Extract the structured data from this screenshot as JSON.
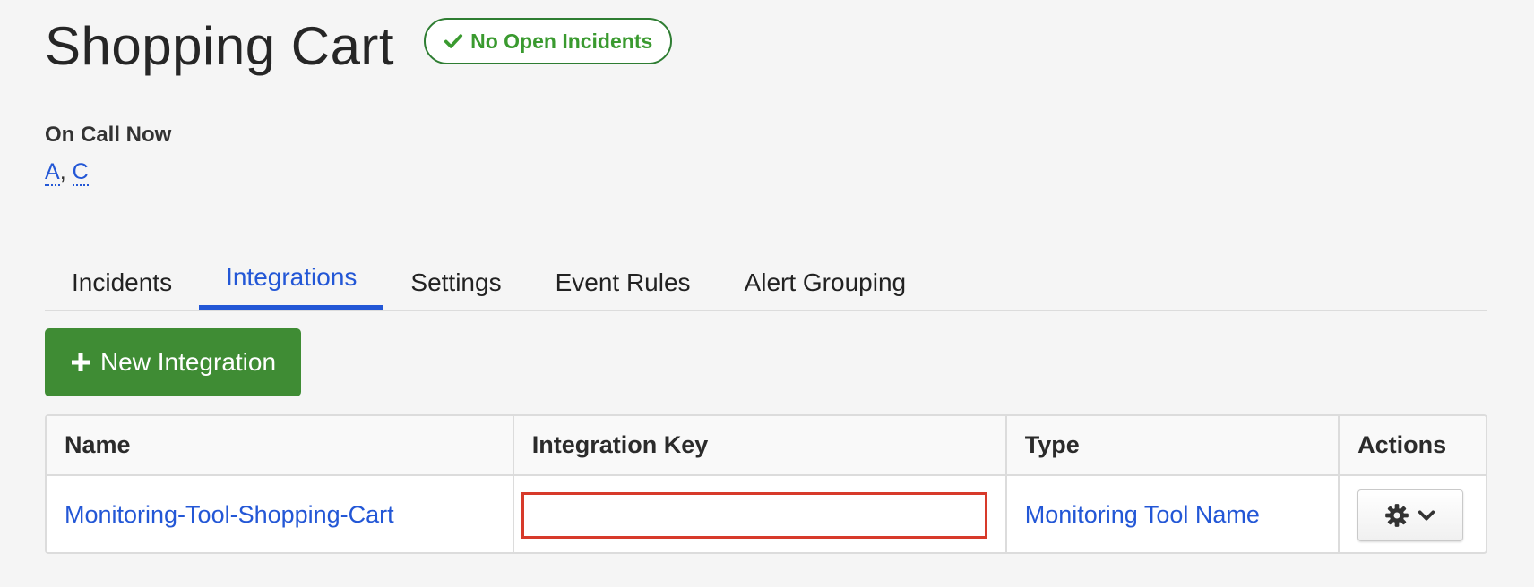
{
  "service": {
    "title": "Shopping Cart",
    "status_badge": "No Open Incidents"
  },
  "oncall": {
    "label": "On Call Now",
    "users": [
      "A",
      "C"
    ],
    "separator": ","
  },
  "tabs": [
    {
      "label": "Incidents",
      "active": false
    },
    {
      "label": "Integrations",
      "active": true
    },
    {
      "label": "Settings",
      "active": false
    },
    {
      "label": "Event Rules",
      "active": false
    },
    {
      "label": "Alert Grouping",
      "active": false
    }
  ],
  "toolbar": {
    "new_integration_label": "New Integration"
  },
  "table": {
    "columns": [
      "Name",
      "Integration Key",
      "Type",
      "Actions"
    ],
    "rows": [
      {
        "name": "Monitoring-Tool-Shopping-Cart",
        "integration_key": "",
        "type": "Monitoring Tool Name"
      }
    ]
  },
  "colors": {
    "accent": "#2357d6",
    "success": "#3a9a2f",
    "primary_button": "#3f8c34",
    "highlight_box": "#d73a2a"
  },
  "icons": {
    "status": "check-icon",
    "new_integration": "plus-icon",
    "actions": [
      "gear-icon",
      "chevron-down-icon"
    ]
  }
}
